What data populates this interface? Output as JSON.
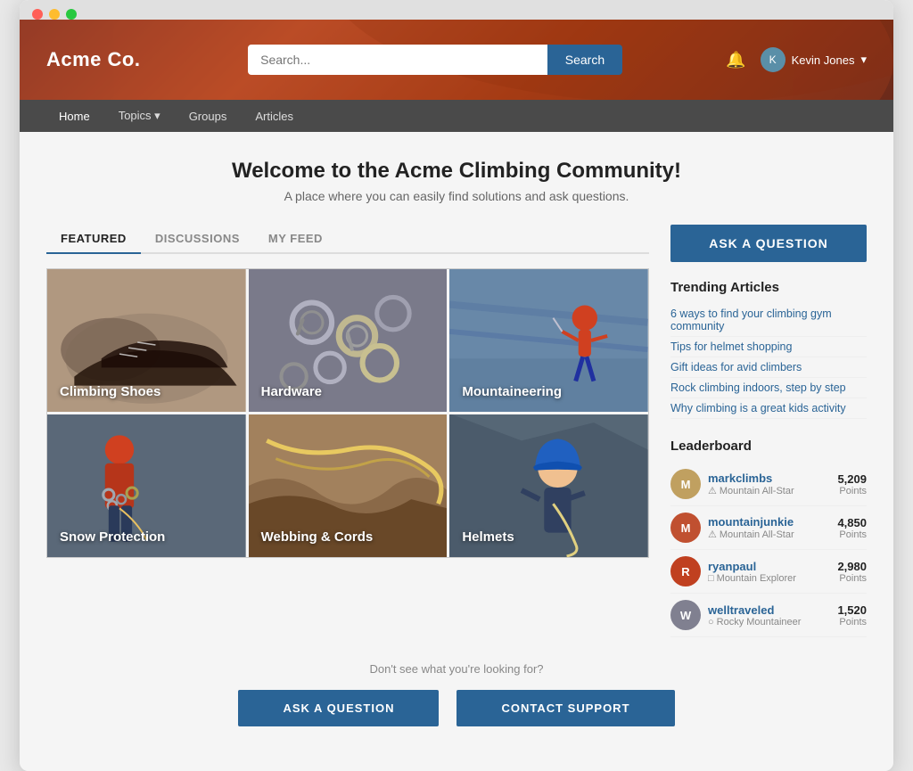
{
  "browser": {
    "dots": [
      "red",
      "yellow",
      "green"
    ]
  },
  "header": {
    "logo": "Acme Co.",
    "search_placeholder": "Search...",
    "search_btn": "Search",
    "user_name": "Kevin Jones",
    "user_initial": "K"
  },
  "nav": {
    "items": [
      {
        "label": "Home",
        "active": true
      },
      {
        "label": "Topics",
        "has_dropdown": true
      },
      {
        "label": "Groups"
      },
      {
        "label": "Articles"
      }
    ]
  },
  "page": {
    "title": "Welcome to the Acme Climbing Community!",
    "subtitle": "A place where you can easily find solutions and ask questions."
  },
  "tabs": [
    {
      "label": "FEATURED",
      "active": true
    },
    {
      "label": "DISCUSSIONS"
    },
    {
      "label": "MY FEED"
    }
  ],
  "featured_grid": [
    {
      "label": "Climbing Shoes",
      "bg": "shoes"
    },
    {
      "label": "Hardware",
      "bg": "hardware"
    },
    {
      "label": "Mountaineering",
      "bg": "mountaineering"
    },
    {
      "label": "Snow Protection",
      "bg": "snow"
    },
    {
      "label": "Webbing & Cords",
      "bg": "webbing"
    },
    {
      "label": "Helmets",
      "bg": "helmets"
    }
  ],
  "sidebar": {
    "ask_btn": "ASK A QUESTION",
    "trending_title": "Trending Articles",
    "trending_items": [
      "6 ways to find your climbing gym community",
      "Tips for helmet shopping",
      "Gift ideas for avid climbers",
      "Rock climbing indoors, step by step",
      "Why climbing is a great kids activity"
    ],
    "leaderboard_title": "Leaderboard",
    "leaders": [
      {
        "name": "markclimbs",
        "badge": "Mountain All-Star",
        "points": "5,209",
        "color": "#c0a060"
      },
      {
        "name": "mountainjunkie",
        "badge": "Mountain All-Star",
        "points": "4,850",
        "color": "#c05030"
      },
      {
        "name": "ryanpaul",
        "badge": "Mountain Explorer",
        "points": "2,980",
        "color": "#c04020"
      },
      {
        "name": "welltraveled",
        "badge": "Rocky Mountaineer",
        "points": "1,520",
        "color": "#808090"
      }
    ],
    "points_label": "Points"
  },
  "bottom": {
    "hint": "Don't see what you're looking for?",
    "btn1": "ASK A QUESTION",
    "btn2": "CONTACT SUPPORT"
  }
}
